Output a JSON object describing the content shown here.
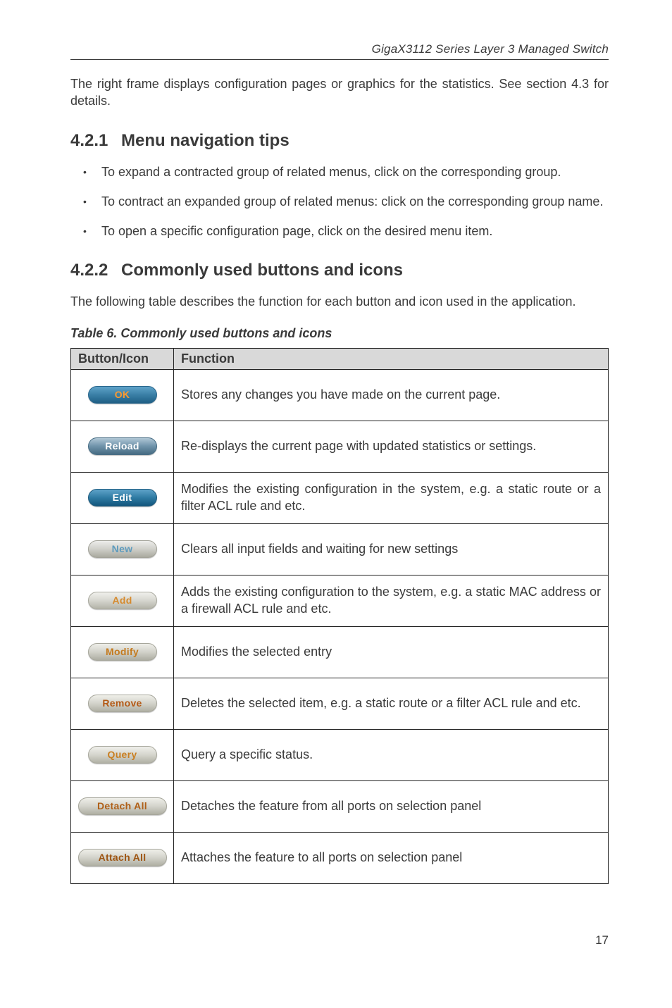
{
  "header": {
    "running": "GigaX3112 Series Layer 3 Managed Switch"
  },
  "intro_para": "The right frame displays configuration pages or graphics for the statistics. See section 4.3 for details.",
  "section_421": {
    "num": "4.2.1",
    "title": "Menu navigation tips",
    "bullets": [
      "To expand a contracted group of related menus, click  on the corresponding group.",
      "To contract an expanded group of related menus: click  on the corresponding group name.",
      "To open a specific configuration page, click on the desired menu item."
    ]
  },
  "section_422": {
    "num": "4.2.2",
    "title": "Commonly used buttons and icons",
    "para": "The following table describes the function for each button and icon used in the application."
  },
  "table": {
    "caption": "Table 6.  Commonly used buttons and icons",
    "headers": {
      "col1": "Button/Icon",
      "col2": "Function"
    },
    "rows": [
      {
        "label": "OK",
        "cls": "ok",
        "wide": false,
        "func": "Stores any changes you have made on the current page."
      },
      {
        "label": "Reload",
        "cls": "reload",
        "wide": false,
        "func": "Re-displays the current page with updated statistics or settings."
      },
      {
        "label": "Edit",
        "cls": "edit",
        "wide": false,
        "func": "Modifies the existing configuration in the system, e.g. a static route or a filter ACL rule and etc."
      },
      {
        "label": "New",
        "cls": "newbtn",
        "wide": false,
        "func": "Clears all input fields and waiting for new settings"
      },
      {
        "label": "Add",
        "cls": "add",
        "wide": false,
        "func": "Adds the existing configuration to the system, e.g. a static MAC address or a firewall ACL rule and etc."
      },
      {
        "label": "Modify",
        "cls": "modify",
        "wide": false,
        "func": "Modifies the selected entry"
      },
      {
        "label": "Remove",
        "cls": "remove",
        "wide": false,
        "func": "Deletes the selected item, e.g. a static route or a filter ACL rule and etc."
      },
      {
        "label": "Query",
        "cls": "query",
        "wide": false,
        "func": "Query a specific status."
      },
      {
        "label": "Detach All",
        "cls": "detach",
        "wide": true,
        "func": "Detaches the feature from all ports on selection panel"
      },
      {
        "label": "Attach All",
        "cls": "attach",
        "wide": true,
        "func": "Attaches the feature to all ports on selection panel"
      }
    ]
  },
  "page_number": "17"
}
